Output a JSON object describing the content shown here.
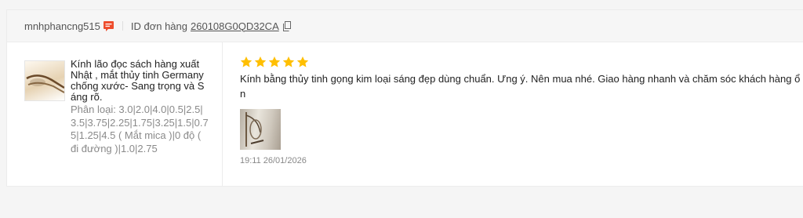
{
  "order": {
    "username": "mnhphancng515",
    "order_id_label": "ID đơn hàng",
    "order_id": "260108G0QD32CA"
  },
  "product": {
    "name": "Kính lão đọc sách hàng xuất Nhật , mắt thủy tinh Germany chống xước- Sang trọng và S áng rõ.",
    "variation": "Phân loại: 3.0|2.0|4.0|0.5|2.5|3.5|3.75|2.25|1.75|3.25|1.5|0.75|1.25|4.5 ( Mắt mica )|0 độ ( đi đường )|1.0|2.75"
  },
  "review": {
    "rating": 5,
    "comment": "Kính bằng thủy tinh gọng kim loại sáng đẹp dùng chuẩn. Ưng ý. Nên mua nhé. Giao hàng nhanh và chăm sóc khách hàng ổ n",
    "timestamp": "19:11 26/01/2026"
  },
  "colors": {
    "star": "#ffbf00",
    "chat_icon": "#ee4d2d"
  }
}
